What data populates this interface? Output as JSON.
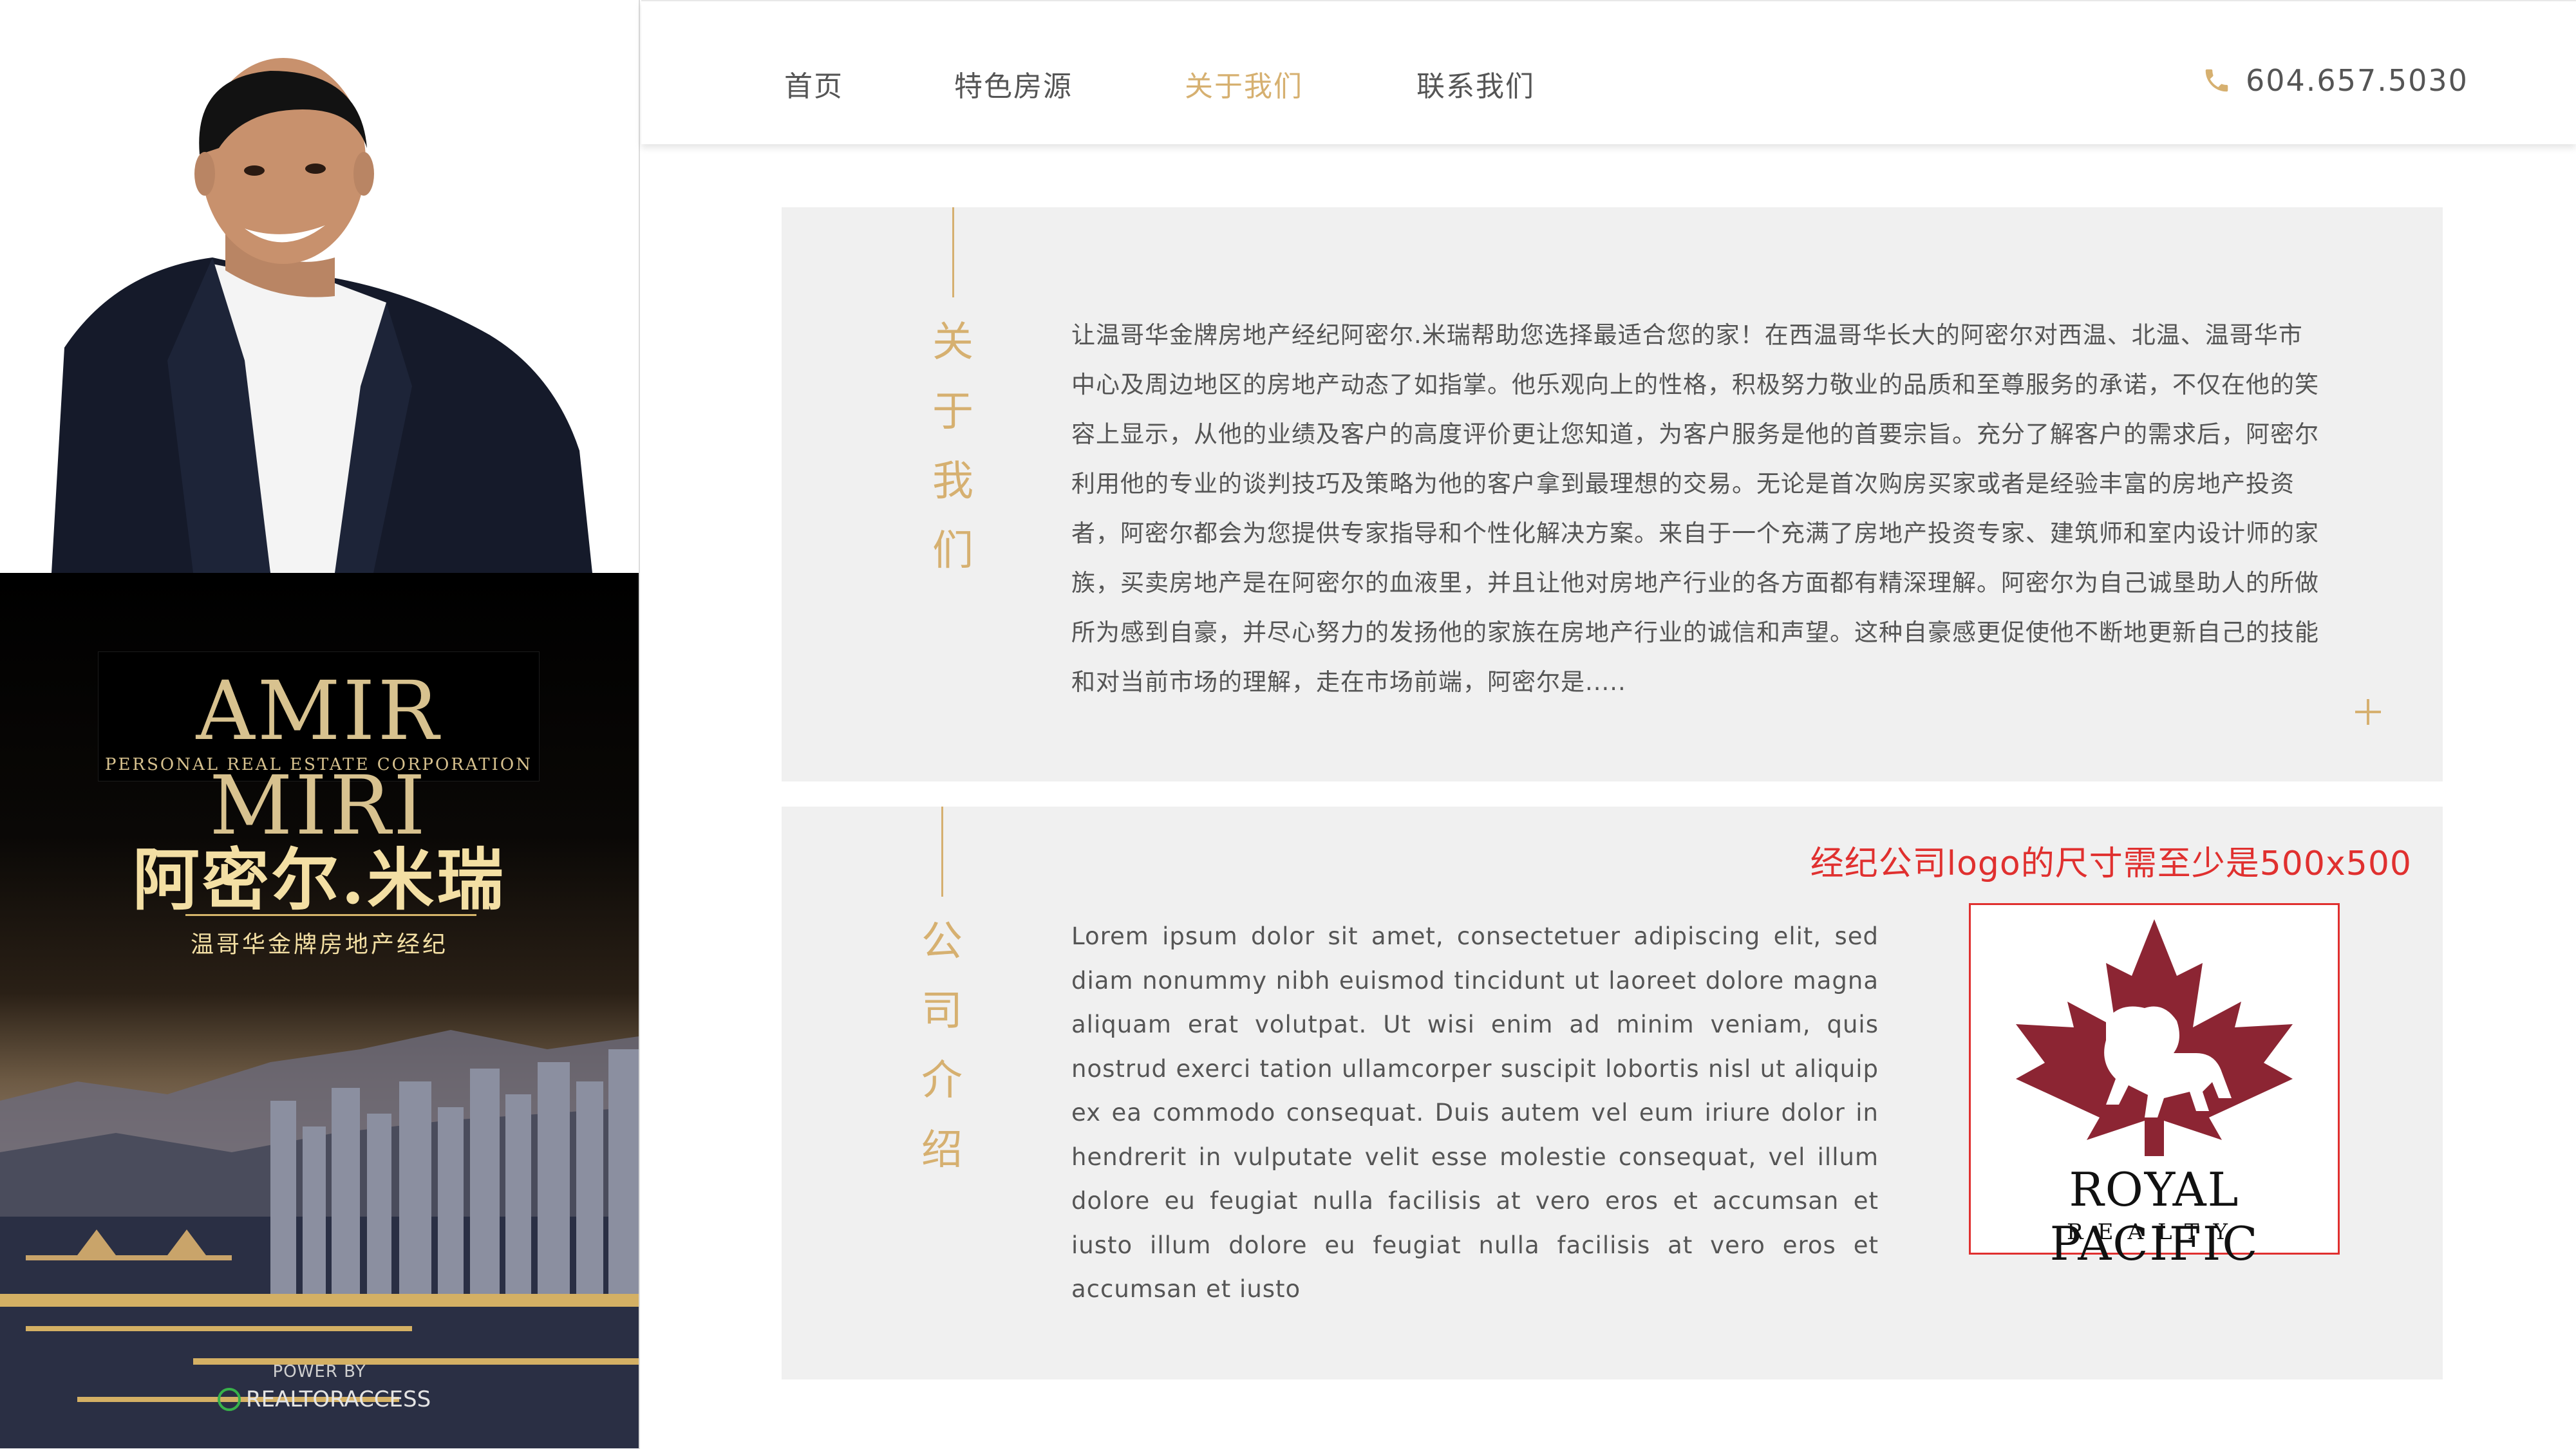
{
  "nav": {
    "items": [
      {
        "label": "首页"
      },
      {
        "label": "特色房源"
      },
      {
        "label": "关于我们"
      },
      {
        "label": "联系我们"
      }
    ],
    "active_index": 2,
    "phone": "604.657.5030",
    "phone_icon": "phone-icon"
  },
  "profile": {
    "logo_name": "AMIR MIRI",
    "logo_sub": "PERSONAL REAL ESTATE CORPORATION",
    "agent_name": "阿密尔.米瑞",
    "agent_title": "温哥华金牌房地产经纪",
    "power_by": "POWER BY",
    "powered_brand": "REALTORACCESS"
  },
  "about": {
    "title_chars": [
      "关",
      "于",
      "我",
      "们"
    ],
    "body": "让温哥华金牌房地产经纪阿密尔.米瑞帮助您选择最适合您的家！在西温哥华长大的阿密尔对西温、北温、温哥华市中心及周边地区的房地产动态了如指掌。他乐观向上的性格，积极努力敬业的品质和至尊服务的承诺，不仅在他的笑容上显示，从他的业绩及客户的高度评价更让您知道，为客户服务是他的首要宗旨。充分了解客户的需求后，阿密尔利用他的专业的谈判技巧及策略为他的客户拿到最理想的交易。无论是首次购房买家或者是经验丰富的房地产投资者，阿密尔都会为您提供专家指导和个性化解决方案。来自于一个充满了房地产投资专家、建筑师和室内设计师的家族，买卖房地产是在阿密尔的血液里，并且让他对房地产行业的各方面都有精深理解。阿密尔为自己诚垦助人的所做所为感到自豪，并尽心努力的发扬他的家族在房地产行业的诚信和声望。这种自豪感更促使他不断地更新自己的技能和对当前市场的理解，走在市场前端，阿密尔是.....",
    "expand_icon": "plus-icon"
  },
  "company": {
    "title_chars": [
      "公",
      "司",
      "介",
      "绍"
    ],
    "body": "Lorem ipsum dolor sit amet, consectetuer adipiscing elit, sed diam nonummy nibh euismod tincidunt ut laoreet dolore magna aliquam erat volutpat. Ut wisi enim ad minim veniam, quis nostrud exerci tation ullamcorper suscipit lobortis nisl ut aliquip ex ea commodo consequat. Duis autem vel eum iriure dolor in hendrerit in vulputate velit esse molestie consequat, vel illum dolore eu feugiat nulla facilisis at vero eros et accumsan et iusto illum dolore eu feugiat nulla facilisis at vero eros et accumsan et iusto",
    "logo_note": "经纪公司logo的尺寸需至少是500x500",
    "logo_name": "ROYAL PACIFIC",
    "logo_sub": "REALTY",
    "logo_color": "#8c2533"
  },
  "colors": {
    "gold": "#d6b070",
    "text": "#555555",
    "panel": "#f0f0f0",
    "red": "#e0302f"
  }
}
